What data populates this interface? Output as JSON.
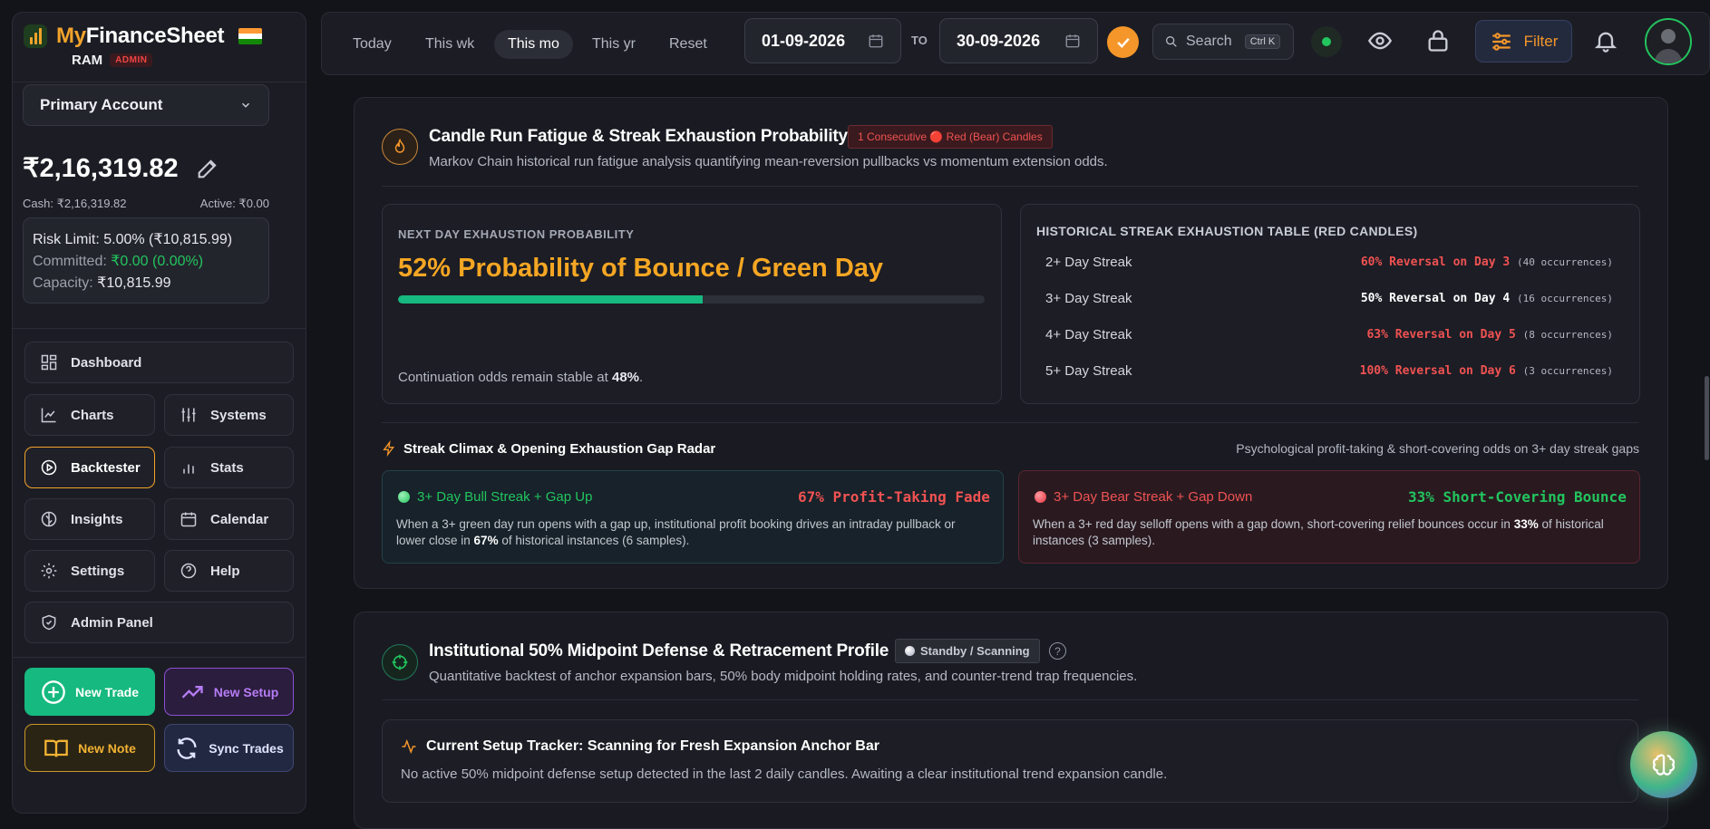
{
  "app": {
    "brand_part1": "My",
    "brand_part2": "FinanceSheet",
    "user_name": "RAM",
    "user_role": "ADMIN"
  },
  "sidebar": {
    "account": "Primary Account",
    "balance": "₹2,16,319.82",
    "cash": "Cash: ₹2,16,319.82",
    "active": "Active: ₹0.00",
    "risk_label": "Risk Limit:",
    "risk_value": "5.00% (₹10,815.99)",
    "committed_label": "Committed:",
    "committed_value": "₹0.00 (0.00%)",
    "capacity_label": "Capacity:",
    "capacity_value": "₹10,815.99",
    "nav": {
      "dashboard": "Dashboard",
      "charts": "Charts",
      "systems": "Systems",
      "backtester": "Backtester",
      "stats": "Stats",
      "insights": "Insights",
      "calendar": "Calendar",
      "settings": "Settings",
      "help": "Help",
      "admin": "Admin Panel"
    },
    "actions": {
      "new_trade": "New Trade",
      "new_setup": "New Setup",
      "new_note": "New Note",
      "sync_trades": "Sync Trades"
    }
  },
  "topbar": {
    "tabs": [
      "Today",
      "This wk",
      "This mo",
      "This yr",
      "Reset"
    ],
    "selected_tab": "This mo",
    "date_from": "01-09-2026",
    "to_label": "TO",
    "date_to": "30-09-2026",
    "search_label": "Search",
    "search_shortcut": "Ctrl K",
    "filter_label": "Filter"
  },
  "streak_card": {
    "title": "Candle Run Fatigue & Streak Exhaustion Probability",
    "badge": "1 Consecutive 🔴 Red (Bear) Candles",
    "subtitle": "Markov Chain historical run fatigue analysis quantifying mean-reversion pullbacks vs momentum extension odds.",
    "next_day": {
      "label": "NEXT DAY EXHAUSTION PROBABILITY",
      "headline": "52% Probability of Bounce / Green Day",
      "probability": 0.52,
      "continuation_text": "Continuation odds remain stable at ",
      "continuation_value": "48%",
      "continuation_end": "."
    },
    "table": {
      "title": "HISTORICAL STREAK EXHAUSTION TABLE (RED CANDLES)",
      "rows": [
        {
          "streak": "2+ Day Streak",
          "result": "60% Reversal on Day 3",
          "occurrences": "(40 occurrences)",
          "color": "#f05252"
        },
        {
          "streak": "3+ Day Streak",
          "result": "50% Reversal on Day 4",
          "occurrences": "(16 occurrences)",
          "color": "#ffffff"
        },
        {
          "streak": "4+ Day Streak",
          "result": "63% Reversal on Day 5",
          "occurrences": "(8 occurrences)",
          "color": "#f05252"
        },
        {
          "streak": "5+ Day Streak",
          "result": "100% Reversal on Day 6",
          "occurrences": "(3 occurrences)",
          "color": "#f05252"
        }
      ]
    },
    "radar": {
      "title": "Streak Climax & Opening Exhaustion Gap Radar",
      "right_note": "Psychological profit-taking & short-covering odds on 3+ day streak gaps",
      "bull": {
        "title": "3+ Day Bull Streak + Gap Up",
        "stat": "67% Profit-Taking Fade",
        "text_a": "When a 3+ green day run opens with a gap up, institutional profit booking drives an intraday pullback or lower close in ",
        "text_b": "67%",
        "text_c": " of historical instances (6 samples)."
      },
      "bear": {
        "title": "3+ Day Bear Streak + Gap Down",
        "stat": "33% Short-Covering Bounce",
        "text_a": "When a 3+ red day selloff opens with a gap down, short-covering relief bounces occur in ",
        "text_b": "33%",
        "text_c": " of historical instances (3 samples)."
      }
    }
  },
  "midpoint_card": {
    "title": "Institutional 50% Midpoint Defense & Retracement Profile",
    "badge": "Standby / Scanning",
    "subtitle": "Quantitative backtest of anchor expansion bars, 50% body midpoint holding rates, and counter-trend trap frequencies.",
    "tracker_title": "Current Setup Tracker: Scanning for Fresh Expansion Anchor Bar",
    "tracker_text": "No active 50% midpoint defense setup detected in the last 2 daily candles. Awaiting a clear institutional trend expansion candle."
  },
  "colors": {
    "accent": "#f2a32b",
    "green": "#22c55e",
    "red": "#f05252",
    "bg": "#131419",
    "card": "#1a1b22"
  }
}
